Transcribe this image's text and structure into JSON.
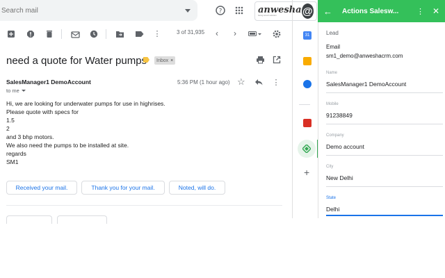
{
  "search": {
    "placeholder": "Search mail"
  },
  "brand": {
    "name": "anwesha",
    "tagline": "being smart solution",
    "at": "@"
  },
  "toolbar": {
    "page_count": "3 of 31,935"
  },
  "email": {
    "subject": "need a quote for Water pumps",
    "label": "Inbox",
    "sender": "SalesManager1 DemoAccount",
    "to": "to me",
    "timestamp": "5:36 PM (1 hour ago)",
    "body": [
      "Hi, we are looking for underwater pumps for use in highrises.",
      "Please quote with specs for",
      "1.5",
      "2",
      "and 3 bhp motors.",
      "We also need the pumps to be installed at site.",
      "regards",
      "SM1"
    ],
    "smart_replies": [
      "Received your mail.",
      "Thank you for your mail.",
      "Noted, will do."
    ]
  },
  "panel": {
    "title": "Actions Salesw...",
    "header_color": "#34c05a",
    "section": "Lead",
    "email_label": "Email",
    "email_value": "sm1_demo@anweshacrm.com",
    "fields": [
      {
        "label": "Name",
        "value": "SalesManager1 DemoAccount"
      },
      {
        "label": "Mobile",
        "value": "91238849"
      },
      {
        "label": "Company",
        "value": "Demo account"
      },
      {
        "label": "City",
        "value": "New Delhi"
      },
      {
        "label": "State",
        "value": "Delhi"
      }
    ]
  }
}
